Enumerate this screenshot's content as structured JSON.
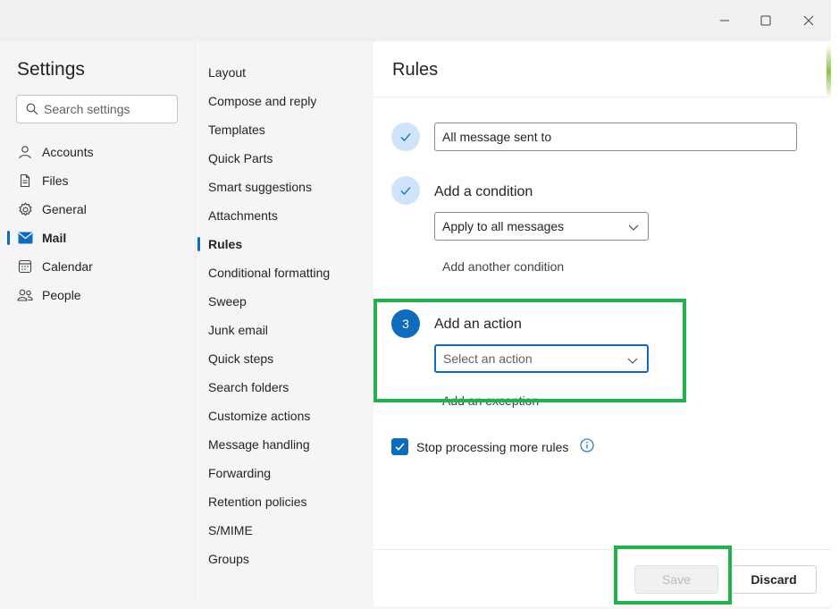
{
  "window": {
    "controls": [
      "minimize",
      "maximize",
      "close"
    ]
  },
  "settings": {
    "title": "Settings",
    "search_placeholder": "Search settings"
  },
  "left_nav": {
    "items": [
      {
        "label": "Accounts",
        "icon": "person-icon",
        "active": false
      },
      {
        "label": "Files",
        "icon": "file-icon",
        "active": false
      },
      {
        "label": "General",
        "icon": "gear-icon",
        "active": false
      },
      {
        "label": "Mail",
        "icon": "mail-icon",
        "active": true
      },
      {
        "label": "Calendar",
        "icon": "calendar-icon",
        "active": false
      },
      {
        "label": "People",
        "icon": "people-icon",
        "active": false
      }
    ]
  },
  "mail_nav": {
    "items": [
      {
        "label": "Layout",
        "active": false
      },
      {
        "label": "Compose and reply",
        "active": false
      },
      {
        "label": "Templates",
        "active": false
      },
      {
        "label": "Quick Parts",
        "active": false
      },
      {
        "label": "Smart suggestions",
        "active": false
      },
      {
        "label": "Attachments",
        "active": false
      },
      {
        "label": "Rules",
        "active": true
      },
      {
        "label": "Conditional formatting",
        "active": false
      },
      {
        "label": "Sweep",
        "active": false
      },
      {
        "label": "Junk email",
        "active": false
      },
      {
        "label": "Quick steps",
        "active": false
      },
      {
        "label": "Search folders",
        "active": false
      },
      {
        "label": "Customize actions",
        "active": false
      },
      {
        "label": "Message handling",
        "active": false
      },
      {
        "label": "Forwarding",
        "active": false
      },
      {
        "label": "Retention policies",
        "active": false
      },
      {
        "label": "S/MIME",
        "active": false
      },
      {
        "label": "Groups",
        "active": false
      }
    ]
  },
  "rules": {
    "title": "Rules",
    "rule_name_value": "All message sent to",
    "condition_label": "Add a condition",
    "condition_value": "Apply to all messages",
    "add_another_condition": "Add another condition",
    "action_step_number": "3",
    "action_label": "Add an action",
    "action_placeholder": "Select an action",
    "add_exception": "Add an exception",
    "stop_processing_label": "Stop processing more rules",
    "stop_processing_checked": true,
    "save_label": "Save",
    "discard_label": "Discard"
  },
  "colors": {
    "accent": "#0f6cbd",
    "highlight": "#22b14c"
  }
}
